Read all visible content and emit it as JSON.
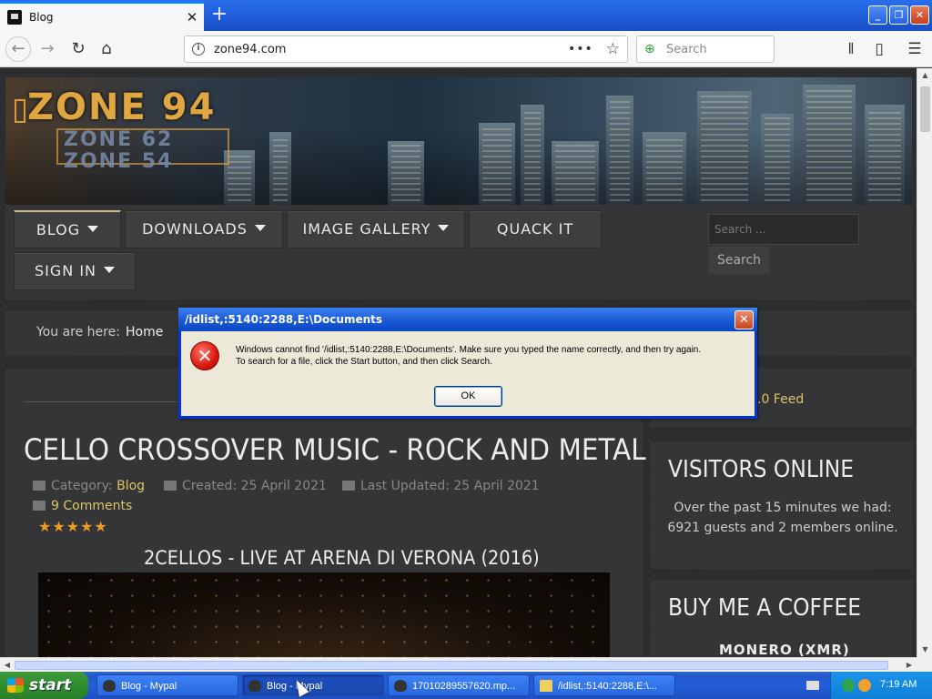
{
  "browser": {
    "tab_title": "Blog",
    "new_tab_label": "+",
    "url": "zone94.com",
    "search_placeholder": "Search",
    "icons": {
      "back": "arrow-left",
      "forward": "arrow-right",
      "reload": "reload",
      "home": "home",
      "info": "info",
      "page_actions": "dots",
      "bookmark": "star",
      "library": "library",
      "sidebar": "sidebar",
      "menu": "hamburger"
    }
  },
  "site": {
    "logo": "ZONE 94",
    "logo_sub1": "ZONE 62",
    "logo_sub2": "ZONE 54",
    "menu": {
      "blog": "BLOG",
      "downloads": "DOWNLOADS",
      "gallery": "IMAGE GALLERY",
      "quack": "QUACK IT",
      "signin": "SIGN IN"
    },
    "search_placeholder": "Search ...",
    "search_button": "Search",
    "breadcrumb": {
      "prefix": "You are here:",
      "home": "Home"
    },
    "article": {
      "title": "CELLO CROSSOVER MUSIC - ROCK AND METAL",
      "category_label": "Category:",
      "category": "Blog",
      "created": "Created: 25 April 2021",
      "updated": "Last Updated: 25 April 2021",
      "comments": "9 Comments",
      "rating_stars": "★★★★★",
      "rating": 5,
      "video_title": "2CELLOS - LIVE AT ARENA DI VERONA (2016)"
    },
    "feed_partial": ".0 Feed",
    "visitors": {
      "heading": "VISITORS ONLINE",
      "text": "Over the past 15 minutes we had: 6921 guests and 2 members online."
    },
    "coffee": {
      "heading": "BUY ME A COFFEE",
      "monero": "MONERO (XMR)"
    }
  },
  "dialog": {
    "title": "/idlist,:5140:2288,E:\\Documents",
    "message_line1": "Windows cannot find '/idlist,:5140:2288,E:\\Documents'. Make sure you typed the name correctly, and then try again.",
    "message_line2": "To search for a file, click the Start button, and then click Search.",
    "ok_label": "OK",
    "close_label": "✕"
  },
  "taskbar": {
    "start_label": "start",
    "tasks": [
      {
        "label": "Blog - Mypal"
      },
      {
        "label": "Blog - Mypal"
      },
      {
        "label": "17010289557620.mp..."
      },
      {
        "label": "/idlist,:5140:2288,E:\\..."
      }
    ],
    "time": "7:19 AM"
  },
  "colors": {
    "accent": "#dcc56a",
    "rating": "#f09a20",
    "xp_blue": "#245ddb",
    "xp_start": "#2f8e2f"
  }
}
